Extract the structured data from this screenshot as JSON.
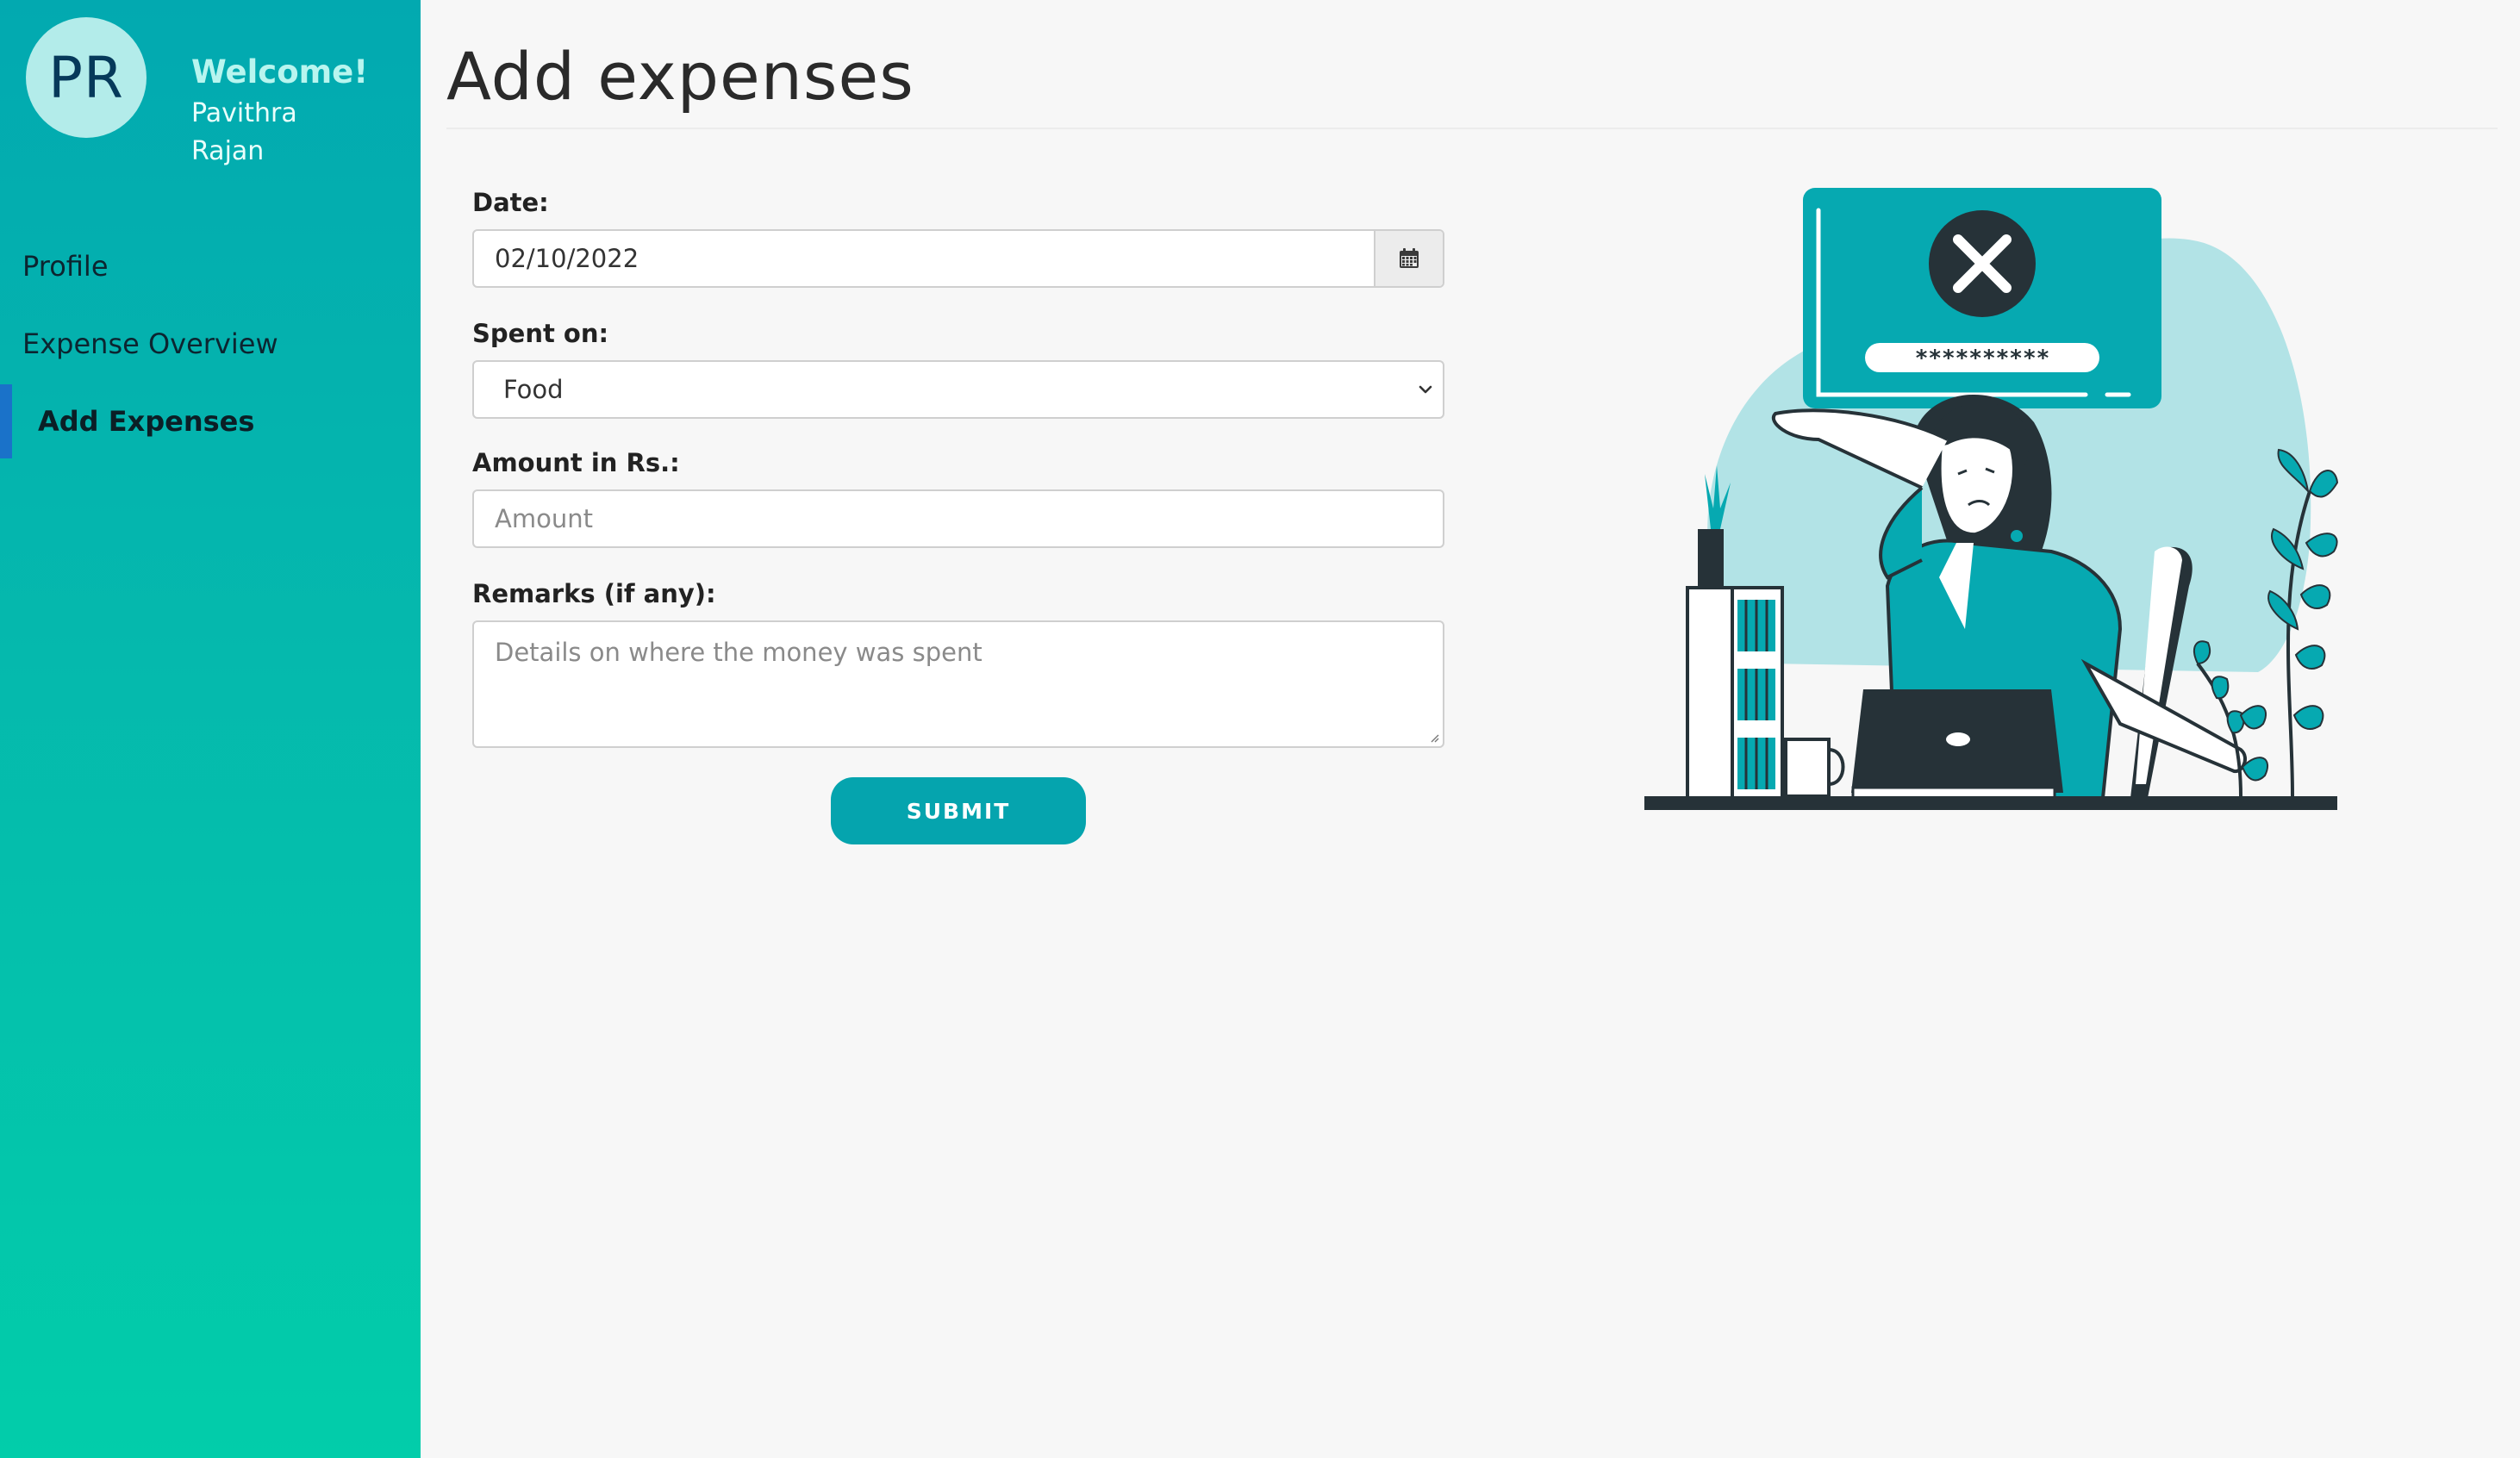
{
  "sidebar": {
    "avatar_initials": "PR",
    "welcome": "Welcome!",
    "user_name": "Pavithra Rajan",
    "items": [
      {
        "label": "Profile",
        "active": false
      },
      {
        "label": "Expense Overview",
        "active": false
      },
      {
        "label": "Add Expenses",
        "active": true
      }
    ]
  },
  "main": {
    "title": "Add expenses",
    "form": {
      "date": {
        "label": "Date:",
        "value": "02/10/2022",
        "icon": "calendar-icon"
      },
      "spent_on": {
        "label": "Spent on:",
        "value": "Food",
        "icon": "chevron-down-icon"
      },
      "amount": {
        "label": "Amount in Rs.:",
        "placeholder": "Amount"
      },
      "remarks": {
        "label": "Remarks (if any):",
        "placeholder": "Details on where the money was spent"
      },
      "submit_label": "SUBMIT"
    },
    "illustration": {
      "password_mask": "**********"
    }
  },
  "colors": {
    "sidebar_top": "#02a9b0",
    "sidebar_bottom": "#02cdaa",
    "accent": "#05a4ae",
    "active_indicator": "#1a72c9",
    "dark": "#263238"
  }
}
